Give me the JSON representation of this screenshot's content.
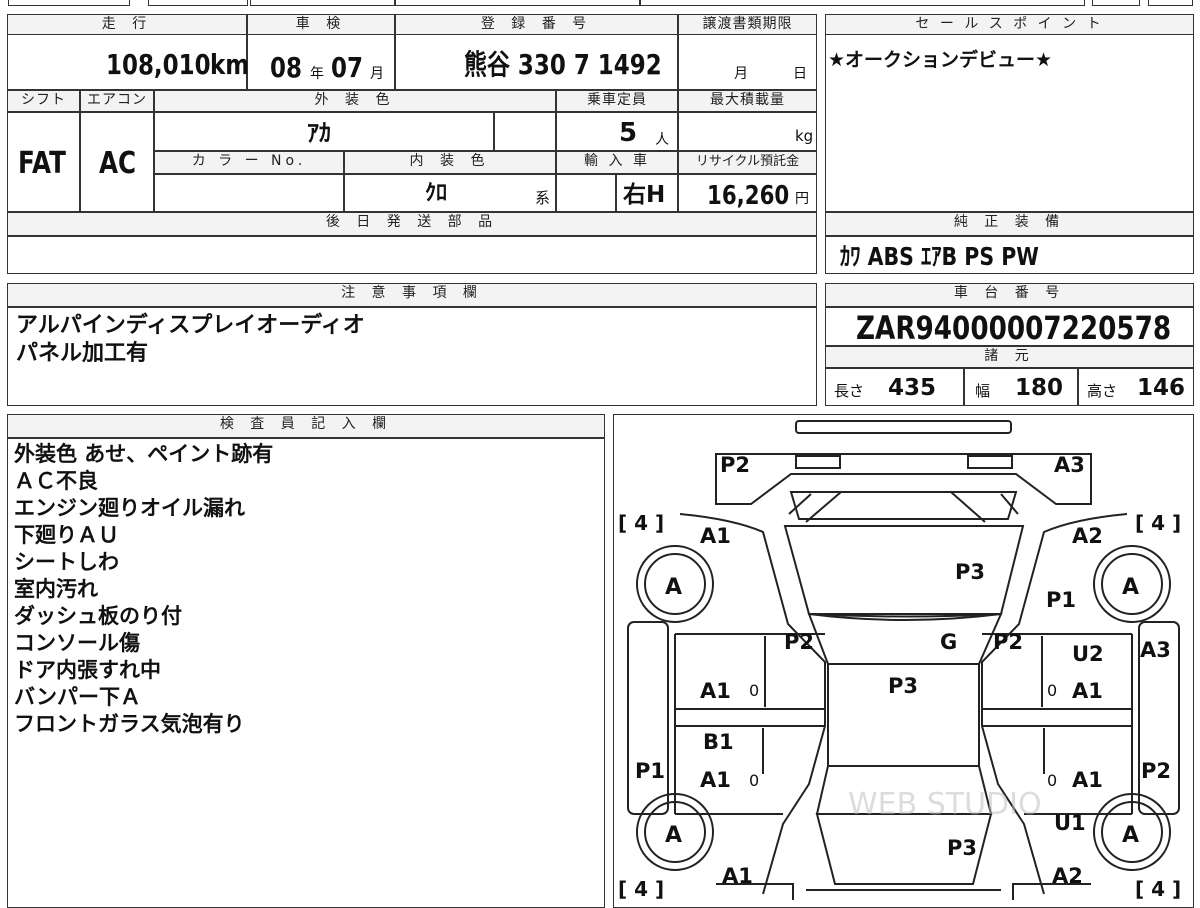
{
  "header": {
    "mileage_label": "走 行",
    "inspection_label": "車 検",
    "registration_label": "登 録 番 号",
    "transfer_label": "譲渡書類期限",
    "mileage_value": "108,010",
    "mileage_unit": "km",
    "inspection_year": "08",
    "inspection_year_unit": "年",
    "inspection_month": "07",
    "inspection_month_unit": "月",
    "registration_value": "熊谷 330 7 1492",
    "transfer_month_unit": "月",
    "transfer_day_unit": "日"
  },
  "specs": {
    "shift_label": "シフト",
    "aircon_label": "エアコン",
    "exterior_color_label": "外 装 色",
    "capacity_label": "乗車定員",
    "max_load_label": "最大積載量",
    "shift_value": "FAT",
    "aircon_value": "AC",
    "exterior_color_value": "ｱｶ",
    "capacity_value": "5",
    "capacity_unit": "人",
    "max_load_unit": "kg",
    "color_no_label": "カ ラ ー No.",
    "interior_color_label": "内 装 色",
    "import_label": "輸 入 車",
    "recycle_label": "リサイクル預託金",
    "interior_color_value": "ｸﾛ",
    "interior_color_suffix": "系",
    "import_value": "右H",
    "recycle_value": "16,260",
    "recycle_unit": "円",
    "later_parts_label": "後 日 発 送 部 品"
  },
  "sales_point": {
    "label": "セ ー ル ス ポ イ ン ト",
    "text": "★オークションデビュー★"
  },
  "equipment": {
    "label": "純 正 装 備",
    "value": "ｶﾜ ABS ｴｱB PS PW"
  },
  "notes": {
    "label": "注 意 事 項 欄",
    "lines": [
      "アルパインディスプレイオーディオ",
      "パネル加工有"
    ]
  },
  "chassis": {
    "label": "車 台 番 号",
    "value": "ZAR94000007220578",
    "dims_label": "諸 元",
    "length_label": "長さ",
    "length_value": "435",
    "width_label": "幅",
    "width_value": "180",
    "height_label": "高さ",
    "height_value": "146"
  },
  "inspector": {
    "label": "検 査 員 記 入 欄",
    "lines": [
      "外装色 あせ、ペイント跡有",
      "ＡＣ不良",
      "エンジン廻りオイル漏れ",
      "下廻りＡＵ",
      "シートしわ",
      "室内汚れ",
      "ダッシュ板のり付",
      "コンソール傷",
      "ドア内張すれ中",
      "バンパー下Ａ",
      "フロントガラス気泡有り"
    ]
  },
  "diagram": {
    "marks": {
      "front_left": "P2",
      "front_right": "A3",
      "fender_front_left": "A1",
      "fender_front_right": "A2",
      "hood": "P3",
      "fender_right_side": "P1",
      "windshield_left": "P2",
      "windshield_center": "G",
      "windshield_right": "P2",
      "door_front_left": "A1",
      "roof": "P3",
      "door_front_right_top": "U2",
      "door_front_right": "A1",
      "side_right_edge": "A3",
      "door_rear_left_top": "B1",
      "door_rear_left": "A1",
      "door_rear_right": "A1",
      "side_left_edge": "P1",
      "side_right_edge_rear": "P2",
      "rear_right_upper": "U1",
      "trunk": "P3",
      "rear_left": "A1",
      "rear_right": "A2"
    },
    "tire_label": "A",
    "tire_count_mark": "[ 4 ]",
    "tire_count_bracket_open": "[",
    "tire_count_value": "4",
    "tire_count_bracket_close": "]",
    "handle_mark": "0"
  }
}
